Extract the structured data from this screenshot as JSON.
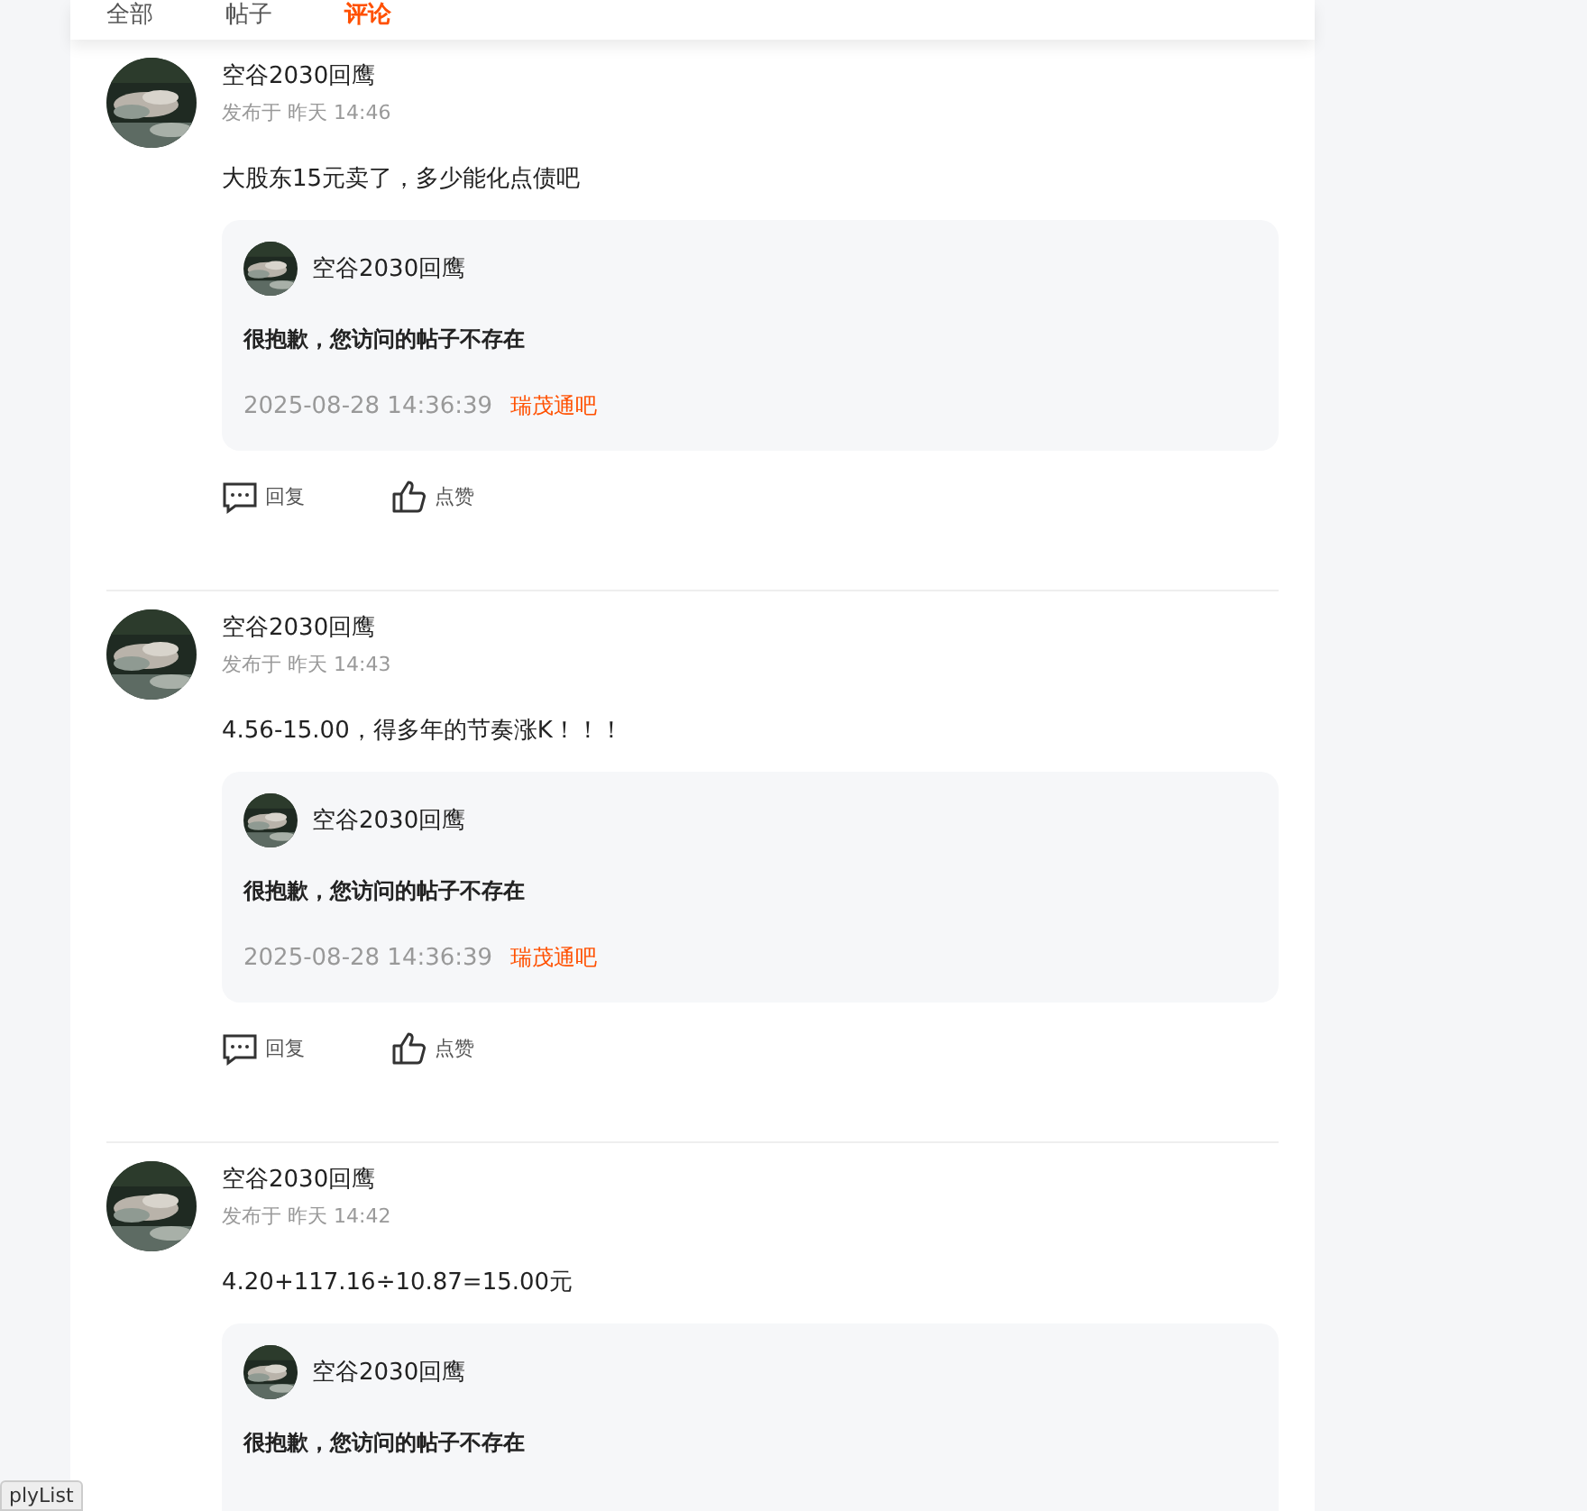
{
  "tabs": [
    {
      "label": "全部",
      "selected": false
    },
    {
      "label": "帖子",
      "selected": false
    },
    {
      "label": "评论",
      "selected": true
    }
  ],
  "comments": [
    {
      "author": "空谷2030回鹰",
      "time": "发布于 昨天 14:46",
      "text": "大股东15元卖了，多少能化点债吧",
      "quote": {
        "author": "空谷2030回鹰",
        "text": "很抱歉，您访问的帖子不存在",
        "date": "2025-08-28 14:36:39",
        "bar": "瑞茂通吧"
      },
      "actions": [
        "回复",
        "点赞"
      ]
    },
    {
      "author": "空谷2030回鹰",
      "time": "发布于 昨天 14:43",
      "text": "4.56-15.00，得多年的节奏涨K！！！",
      "quote": {
        "author": "空谷2030回鹰",
        "text": "很抱歉，您访问的帖子不存在",
        "date": "2025-08-28 14:36:39",
        "bar": "瑞茂通吧"
      },
      "actions": [
        "回复",
        "点赞"
      ]
    },
    {
      "author": "空谷2030回鹰",
      "time": "发布于 昨天 14:42",
      "text": "4.20+117.16÷10.87=15.00元",
      "quote": {
        "author": "空谷2030回鹰",
        "text": "很抱歉，您访问的帖子不存在"
      }
    }
  ],
  "corner_tag": "plyList"
}
